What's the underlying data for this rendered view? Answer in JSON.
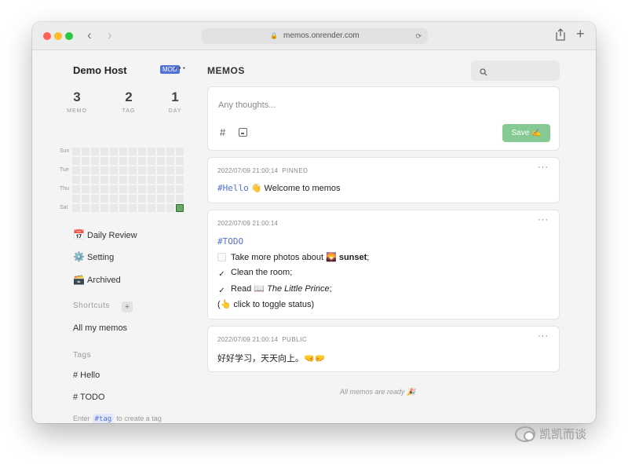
{
  "browser": {
    "url": "memos.onrender.com",
    "back": "‹",
    "forward": "›",
    "new_tab": "+"
  },
  "sidebar": {
    "host_name": "Demo Host",
    "role_badge": "MOD",
    "menu": "···",
    "stats": [
      {
        "value": "3",
        "label": "MEMO"
      },
      {
        "value": "2",
        "label": "TAG"
      },
      {
        "value": "1",
        "label": "DAY"
      }
    ],
    "heatmap_days": [
      "Sun",
      "Tue",
      "Thu",
      "Sat"
    ],
    "heatmap_active_color": "#6aa96a",
    "nav": [
      {
        "icon": "📅",
        "label": "Daily Review"
      },
      {
        "icon": "⚙️",
        "label": "Setting"
      },
      {
        "icon": "🗃️",
        "label": "Archived"
      }
    ],
    "shortcuts_title": "Shortcuts",
    "shortcut_add": "+",
    "shortcuts": [
      "All my memos"
    ],
    "tags_title": "Tags",
    "tags": [
      "# Hello",
      "# TODO"
    ],
    "tag_hint": {
      "before": "Enter",
      "chip": "#tag",
      "after": "to create a tag"
    }
  },
  "main": {
    "title": "MEMOS",
    "search": {
      "placeholder": ""
    },
    "editor": {
      "placeholder": "Any thoughts...",
      "hash_icon": "#",
      "save_label": "Save ✍️"
    },
    "memos": [
      {
        "timestamp": "2022/07/09 21:00:14",
        "status": "PINNED",
        "more": "···",
        "tag": "#Hello",
        "text": " 👋 Welcome to memos"
      },
      {
        "timestamp": "2022/07/09 21:00:14",
        "status": "",
        "more": "···",
        "tag": "#TODO",
        "todo_1_a": "Take more photos about 🌄 ",
        "todo_1_b": "sunset",
        "todo_1_c": ";",
        "todo_2": "Clean the room;",
        "todo_3_a": "Read 📖 ",
        "todo_3_b": "The Little Prince",
        "todo_3_c": ";",
        "check": "✓",
        "note": "(👆 click to toggle status)"
      },
      {
        "timestamp": "2022/07/09 21:00:14",
        "status": "PUBLIC",
        "more": "···",
        "text": "好好学习，天天向上。🤜🤛"
      }
    ],
    "footer": "All memos are ready 🎉"
  },
  "watermark": "凯凯而谈",
  "colors": {
    "accent": "#5371d8",
    "save": "#87c994",
    "window_bg": "#f4f4f5"
  }
}
